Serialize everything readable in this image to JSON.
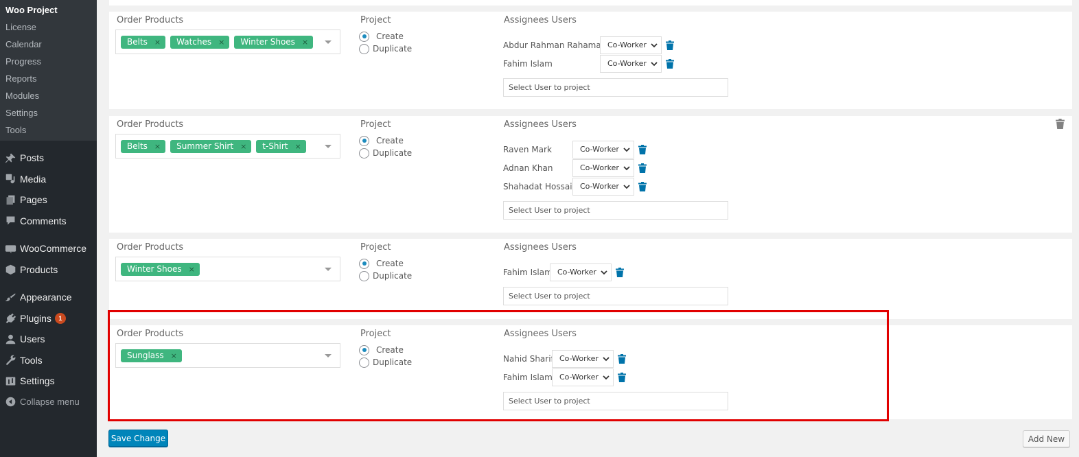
{
  "sidebar": {
    "submenu": [
      {
        "label": "Woo Project",
        "current": true
      },
      {
        "label": "License"
      },
      {
        "label": "Calendar"
      },
      {
        "label": "Progress"
      },
      {
        "label": "Reports"
      },
      {
        "label": "Modules"
      },
      {
        "label": "Settings"
      },
      {
        "label": "Tools"
      }
    ],
    "menu": [
      {
        "label": "Posts",
        "icon": "pin-icon"
      },
      {
        "label": "Media",
        "icon": "media-icon"
      },
      {
        "label": "Pages",
        "icon": "pages-icon"
      },
      {
        "label": "Comments",
        "icon": "comment-icon"
      },
      {
        "label": "WooCommerce",
        "icon": "woocommerce-icon"
      },
      {
        "label": "Products",
        "icon": "box-icon"
      },
      {
        "label": "Appearance",
        "icon": "paintbrush-icon"
      },
      {
        "label": "Plugins",
        "icon": "plug-icon",
        "badge": "1"
      },
      {
        "label": "Users",
        "icon": "user-icon"
      },
      {
        "label": "Tools",
        "icon": "wrench-icon"
      },
      {
        "label": "Settings",
        "icon": "sliders-icon"
      },
      {
        "label": "Collapse menu",
        "icon": "collapse-icon"
      }
    ]
  },
  "labels": {
    "order_products": "Order Products",
    "project": "Project",
    "assignees": "Assignees Users",
    "create": "Create",
    "duplicate": "Duplicate",
    "user_placeholder": "Select User to project",
    "role": "Co-Worker"
  },
  "cards": [
    {
      "products": [
        "Belts",
        "Watches",
        "Winter Shoes"
      ],
      "project": "Create",
      "users": [
        {
          "name": "Abdur Rahman Rahaman",
          "role": "Co-Worker"
        },
        {
          "name": "Fahim Islam",
          "role": "Co-Worker"
        }
      ]
    },
    {
      "products": [
        "Belts",
        "Summer Shirt",
        "t-Shirt"
      ],
      "project": "Create",
      "users": [
        {
          "name": "Raven Mark",
          "role": "Co-Worker"
        },
        {
          "name": "Adnan Khan",
          "role": "Co-Worker"
        },
        {
          "name": "Shahadat Hossain",
          "role": "Co-Worker"
        }
      ]
    },
    {
      "products": [
        "Winter Shoes"
      ],
      "project": "Create",
      "users": [
        {
          "name": "Fahim Islam",
          "role": "Co-Worker"
        }
      ]
    },
    {
      "products": [
        "Sunglass"
      ],
      "project": "Create",
      "users": [
        {
          "name": "Nahid Sharif",
          "role": "Co-Worker"
        },
        {
          "name": "Fahim Islam",
          "role": "Co-Worker"
        }
      ]
    }
  ],
  "actions": {
    "save": "Save Change",
    "add_new": "Add New"
  },
  "colors": {
    "tag": "#3fb67f",
    "primary": "#0085ba",
    "highlight": "#e10000",
    "trash": "#0073aa"
  }
}
